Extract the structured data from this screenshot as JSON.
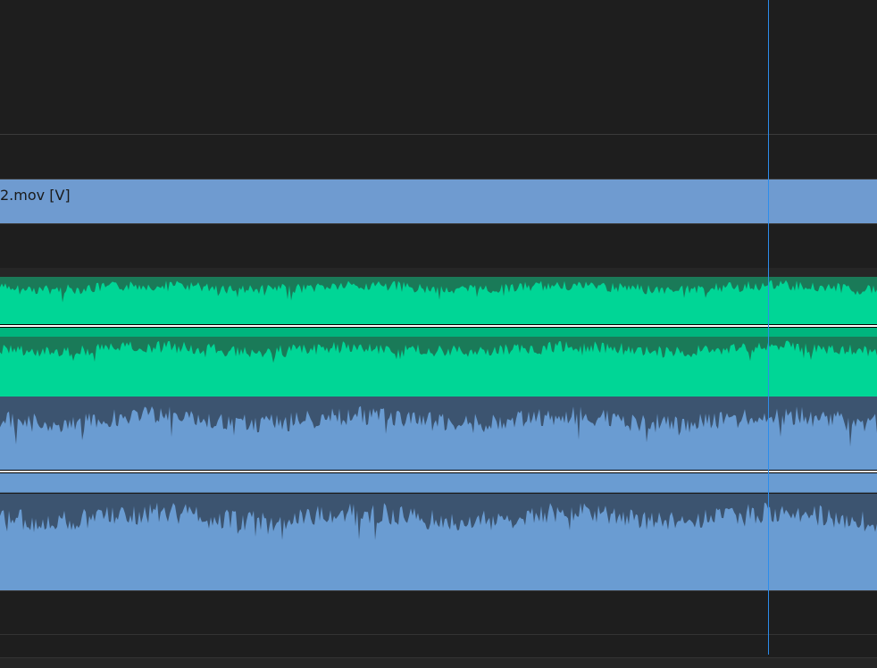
{
  "timeline": {
    "video_clip": {
      "name": "2.mov [V]",
      "color": "#6f9bd0"
    },
    "audio_clip_1": {
      "color_fill": "#00d696",
      "color_peak": "#1a7a58"
    },
    "audio_clip_2": {
      "color_fill": "#6a9cd2",
      "color_peak": "#3c5470"
    },
    "playhead": {
      "color": "#2d8ceb"
    },
    "background_color": "#1e1e1e"
  }
}
